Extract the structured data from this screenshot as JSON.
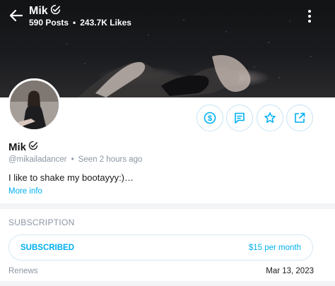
{
  "header": {
    "name": "Mik",
    "posts_count": "590 Posts",
    "likes_count": "243.7K Likes"
  },
  "profile": {
    "name": "Mik",
    "handle": "@mikailadancer",
    "last_seen": "Seen 2 hours ago",
    "bio": "I like to shake my bootayyy:)…",
    "more_info_label": "More info"
  },
  "actions": [
    "dollar-icon",
    "message-icon",
    "star-icon",
    "share-icon"
  ],
  "subscription": {
    "section_title": "SUBSCRIPTION",
    "status": "SUBSCRIBED",
    "price": "$15 per month",
    "renews_label": "Renews",
    "renews_date": "Mar 13, 2023"
  },
  "colors": {
    "accent": "#00aff0",
    "muted": "#8a96a3"
  }
}
